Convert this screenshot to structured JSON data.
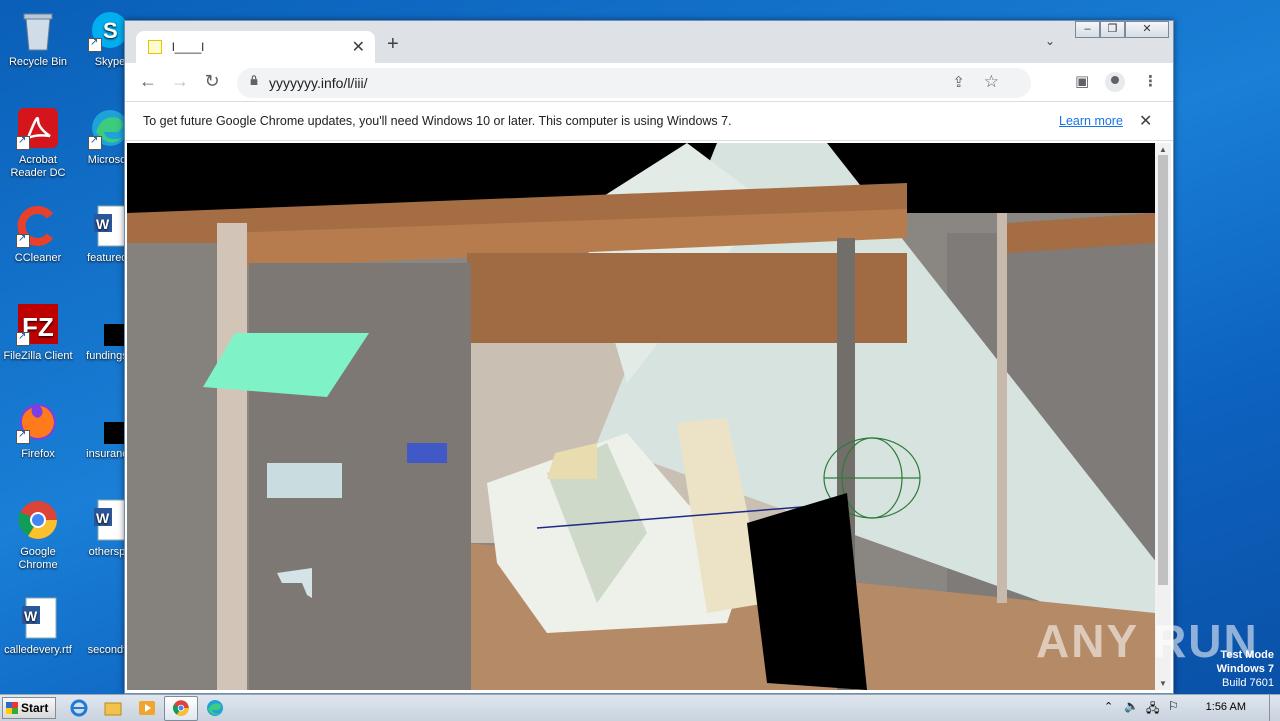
{
  "desktop": {
    "icons": [
      {
        "label": "Recycle Bin"
      },
      {
        "label": "Skype"
      },
      {
        "label": "Acrobat Reader DC"
      },
      {
        "label": "Microsoft"
      },
      {
        "label": "CCleaner"
      },
      {
        "label": "featureds"
      },
      {
        "label": "FileZilla Client"
      },
      {
        "label": "fundingse"
      },
      {
        "label": "Firefox"
      },
      {
        "label": "insurance"
      },
      {
        "label": "Google Chrome"
      },
      {
        "label": "otherspo"
      },
      {
        "label": "calledevery.rtf"
      },
      {
        "label": "secondto"
      }
    ]
  },
  "browser": {
    "tab_title": "l____l",
    "url": "yyyyyyy.info/l/iii/",
    "infobar": {
      "message": "To get future Google Chrome updates, you'll need Windows 10 or later. This computer is using Windows 7.",
      "link": "Learn more"
    }
  },
  "watermark": {
    "brand": "ANY RUN",
    "test_mode": "Test Mode",
    "os": "Windows 7",
    "build": "Build 7601"
  },
  "taskbar": {
    "start_label": "Start",
    "clock": "1:56 AM"
  },
  "colors": {
    "desktop_bg": "#1a7fd6",
    "tabstrip": "#dee1e6",
    "link": "#1a73e8"
  }
}
